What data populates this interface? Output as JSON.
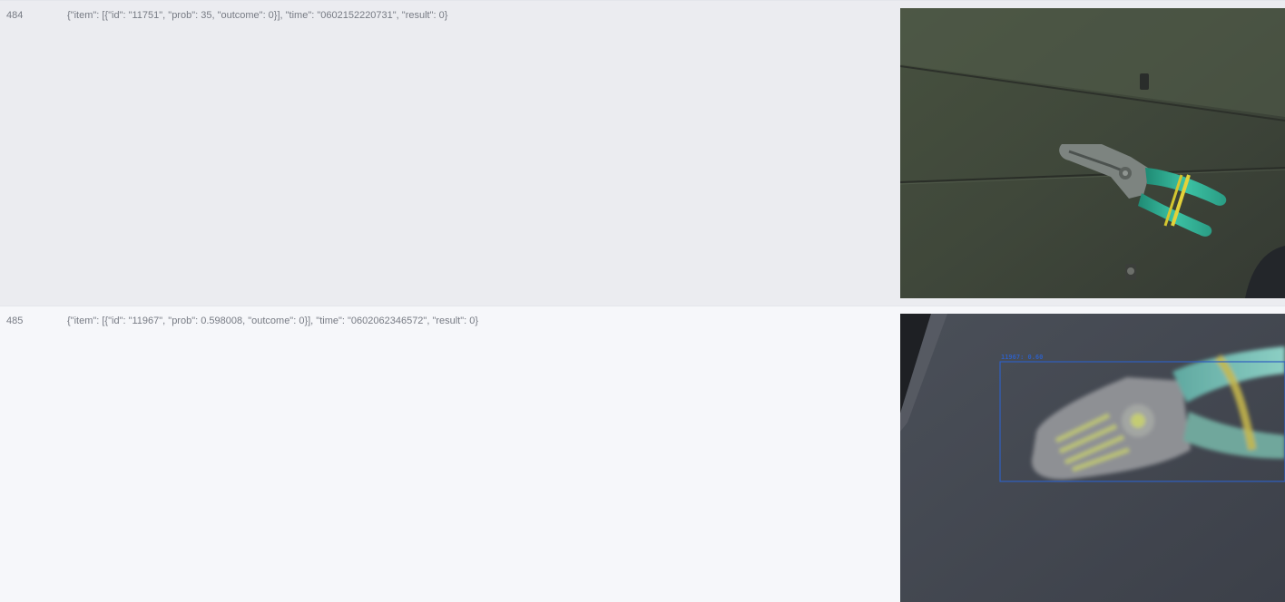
{
  "rows": [
    {
      "index": "484",
      "json": "{\"item\": [{\"id\": \"11751\", \"prob\": 35, \"outcome\": 0}], \"time\": \"0602152220731\", \"result\": 0}",
      "image": {
        "subject": "wire-stripper-photo",
        "detection_label": ""
      }
    },
    {
      "index": "485",
      "json": "{\"item\": [{\"id\": \"11967\", \"prob\": 0.598008, \"outcome\": 0}], \"time\": \"0602062346572\", \"result\": 0}",
      "image": {
        "subject": "wire-stripper-photo-blurred",
        "detection_label": "11967: 0.60"
      }
    }
  ],
  "colors": {
    "row_odd_bg": "#ebecf0",
    "row_even_bg": "#f6f7fa",
    "text": "#777b84",
    "handle_green": "#2fa58c",
    "rubber_band": "#e3d23a",
    "detection_box": "#2f5fc0"
  }
}
